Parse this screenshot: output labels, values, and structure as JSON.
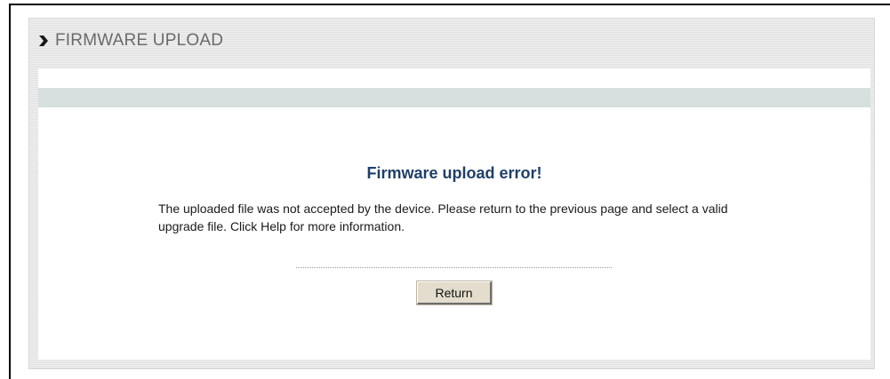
{
  "header": {
    "icon": "right-chevron-icon",
    "title": "FIRMWARE UPLOAD"
  },
  "main": {
    "error_title": "Firmware upload error!",
    "message": "The uploaded file was not accepted by the device. Please return to the previous page and select a valid upgrade file. Click Help for more information.",
    "return_label": "Return"
  },
  "colors": {
    "title_blue": "#1f3f68",
    "band": "#d7dfdf",
    "button_face": "#e4dccc"
  }
}
